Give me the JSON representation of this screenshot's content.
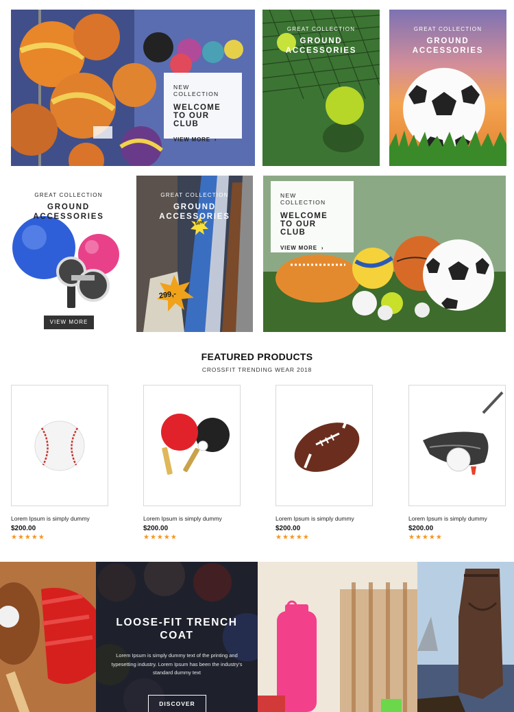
{
  "collection_tiles": {
    "tile1": {
      "kicker": "New Collection",
      "title_line1": "Welcome",
      "title_line2": "to our",
      "title_line3": "Club",
      "link": "View More"
    },
    "tile2": {
      "kicker": "Great Collection",
      "title_line1": "Ground",
      "title_line2": "Accessories"
    },
    "tile3": {
      "kicker": "Great Collection",
      "title_line1": "Ground",
      "title_line2": "Accessories"
    },
    "tile4": {
      "kicker": "Great Collection",
      "title_line1": "Ground",
      "title_line2": "Accessories",
      "button": "View More"
    },
    "tile5": {
      "kicker": "Great Collection",
      "title_line1": "Ground",
      "title_line2": "Accessories",
      "price_tag": "299,-",
      "tag_small": "50%"
    },
    "tile6": {
      "kicker": "New Collection",
      "title_line1": "Welcome",
      "title_line2": "to our",
      "title_line3": "Club",
      "link": "View More"
    }
  },
  "featured": {
    "heading": "FEATURED PRODUCTS",
    "subheading": "CROSSFIT TRENDING WEAR 2018",
    "products": [
      {
        "name": "Lorem Ipsum is simply dummy",
        "price": "$200.00",
        "stars": "★★★★★",
        "rating": 5,
        "icon": "baseball-icon"
      },
      {
        "name": "Lorem Ipsum is simply dummy",
        "price": "$200.00",
        "stars": "★★★★★",
        "rating": 5,
        "icon": "ping-pong-paddles-icon"
      },
      {
        "name": "Lorem Ipsum is simply dummy",
        "price": "$200.00",
        "stars": "★★★★★",
        "rating": 5,
        "icon": "american-football-icon"
      },
      {
        "name": "Lorem Ipsum is simply dummy",
        "price": "$200.00",
        "stars": "★★★★★",
        "rating": 5,
        "icon": "golf-club-icon"
      }
    ]
  },
  "promo_banner": {
    "title_line1": "Loose-Fit Trench",
    "title_line2": "Coat",
    "text": "Lorem Ipsum is simply dummy text of the printing and typesetting industry. Lorem Ipsum has been the industry's standard dummy text",
    "button": "Discover"
  },
  "colors": {
    "accent_star": "#f7941d",
    "button_dark": "#333333"
  }
}
